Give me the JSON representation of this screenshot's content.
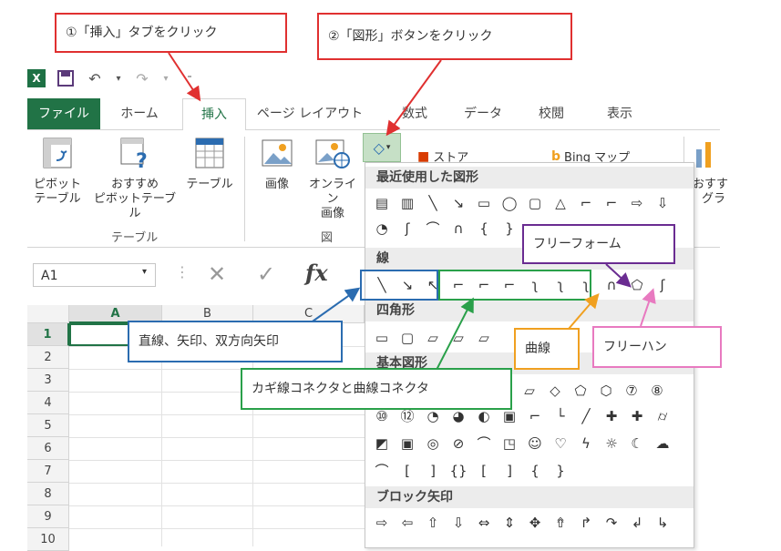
{
  "callouts": {
    "step1": "①「挿入」タブをクリック",
    "step2": "②「図形」ボタンをクリック",
    "straight": "直線、矢印、双方向矢印",
    "elbow": "カギ線コネクタと曲線コネクタ",
    "curve": "曲線",
    "freeform": "フリーフォーム",
    "scribble": "フリーハン"
  },
  "tabs": [
    "ファイル",
    "ホーム",
    "挿入",
    "ページ レイアウト",
    "数式",
    "データ",
    "校閲",
    "表示"
  ],
  "ribbon": {
    "pivot": [
      "ピボット",
      "テーブル"
    ],
    "recommended": [
      "おすすめ",
      "ピボットテーブル"
    ],
    "table": "テーブル",
    "group_table": "テーブル",
    "image": "画像",
    "online_image": [
      "オンライン",
      "画像"
    ],
    "group_figure": "図",
    "store": "ストア",
    "bing": "Bing マップ",
    "recommended_chart": [
      "おすす",
      "グラ"
    ]
  },
  "formula_bar": {
    "name_box": "A1",
    "fx": "fx"
  },
  "grid": {
    "columns": [
      "A",
      "B",
      "C"
    ],
    "rows": [
      "1",
      "2",
      "3",
      "4",
      "5",
      "6",
      "7",
      "8",
      "9",
      "10"
    ]
  },
  "shapes_menu": {
    "sections": [
      "最近使用した図形",
      "線",
      "四角形",
      "基本図形",
      "ブロック矢印"
    ],
    "recent_row1": [
      "▤",
      "▥",
      "╲",
      "↘",
      "▭",
      "◯",
      "▢",
      "△",
      "⌐",
      "⌐",
      "⇨",
      "⇩"
    ],
    "recent_row2": [
      "◔",
      "ʃ",
      "⌒",
      "∩",
      "{",
      "}"
    ],
    "lines": [
      "╲",
      "↘",
      "↖",
      "⌐",
      "⌐",
      "⌐",
      "ʅ",
      "ʅ",
      "ʅ",
      "∩",
      "⬠",
      "ʃ"
    ],
    "rects": [
      "▭",
      "▢",
      "▱",
      "▱",
      "▱"
    ],
    "basic_row1": [
      "▱",
      "◇",
      "⬠",
      "⬡",
      "⑦",
      "⑧"
    ],
    "basic_row2": [
      "⑩",
      "⑫",
      "◔",
      "◕",
      "◐",
      "▣",
      "⌐",
      "└",
      "╱",
      "✚",
      "✚",
      "⌭"
    ],
    "basic_row3": [
      "◩",
      "▣",
      "◎",
      "⊘",
      "⌒",
      "◳",
      "☺",
      "♡",
      "ϟ",
      "☼",
      "☾",
      "☁"
    ],
    "basic_row4": [
      "⌒",
      "[",
      "]",
      "{}",
      "[",
      "]",
      "{",
      "}"
    ],
    "block_row1": [
      "⇨",
      "⇦",
      "⇧",
      "⇩",
      "⇔",
      "⇕",
      "✥",
      "⇮",
      "↱",
      "↷",
      "↲",
      "↳"
    ]
  }
}
